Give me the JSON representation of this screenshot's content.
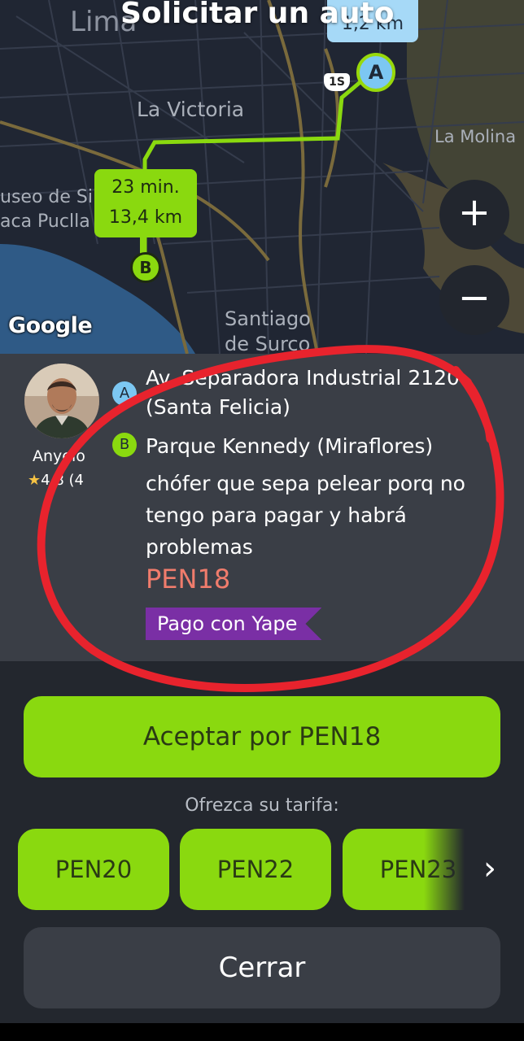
{
  "header": {
    "title": "Solicitar un auto"
  },
  "map": {
    "labels": {
      "lima": "Lima",
      "la_victoria": "La Victoria",
      "la_molina": "La Molina",
      "museo": "useo de Si",
      "huaca": "aca Puclla",
      "santiago": "Santiago",
      "de_surco": "de Surco"
    },
    "top_distance": "1,2 km",
    "marker_a": "A",
    "marker_b": "B",
    "road_shield": "1S",
    "route_time": "23 min.",
    "route_distance": "13,4 km",
    "google_logo": "Google",
    "zoom_in": "+",
    "zoom_out": "−"
  },
  "order": {
    "driver_name": "Anyelo",
    "driver_rating": "4,8 (4",
    "pin_a": "A",
    "pin_b": "B",
    "address_a": "Av. Separadora Industrial 2120 (Santa Felicia)",
    "address_b": "Parque Kennedy (Miraflores)",
    "comment": "chófer que sepa pelear porq no tengo para pagar y habrá problemas",
    "price": "PEN18",
    "payment_tag": "Pago con Yape"
  },
  "actions": {
    "accept_label": "Aceptar por PEN18",
    "offer_label": "Ofrezca su tarifa:",
    "fares": [
      "PEN20",
      "PEN22",
      "PEN23"
    ],
    "close_label": "Cerrar"
  },
  "colors": {
    "accent_green": "#8ad90f",
    "price_red": "#f07c6c",
    "yape_purple": "#7a2fa5",
    "annotation_red": "#e8232d"
  }
}
